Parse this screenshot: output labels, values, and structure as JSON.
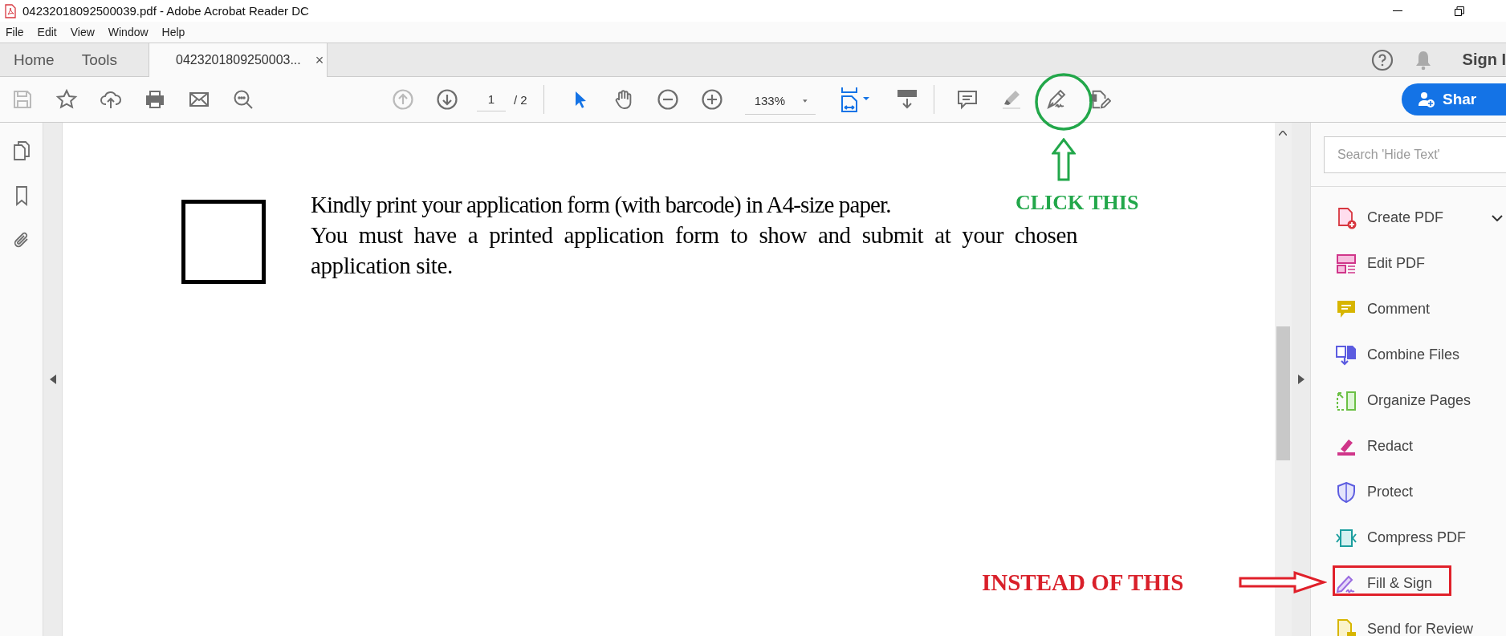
{
  "window": {
    "title": "04232018092500039.pdf - Adobe Acrobat Reader DC"
  },
  "menu": [
    "File",
    "Edit",
    "View",
    "Window",
    "Help"
  ],
  "tabs": [
    {
      "label": "Home",
      "selected": false
    },
    {
      "label": "Tools",
      "selected": false
    },
    {
      "label": "0423201809250003...",
      "selected": true,
      "close": "×"
    }
  ],
  "header_right": {
    "sign_in": "Sign I"
  },
  "toolbar": {
    "file_buttons": [
      {
        "disabled": true
      },
      {
        "disabled": false
      },
      {
        "disabled": false
      },
      {
        "disabled": false
      },
      {
        "disabled": false
      },
      {
        "disabled": false
      }
    ],
    "page_buttons": [
      {
        "disabled": true
      },
      {
        "disabled": false
      }
    ],
    "page_number": "1",
    "page_count": "/ 2",
    "view_tools": [
      {
        "selected": true
      },
      {
        "selected": false
      }
    ],
    "zoom": "133%",
    "share": "Shar"
  },
  "document": {
    "paragraphs": [
      "Kindly print your application form (with barcode) in A4-size paper.",
      "You must have a printed application form to show and submit at your chosen application site."
    ]
  },
  "tools_panel": {
    "search": {
      "placeholder": "Search 'Hide Text'"
    },
    "items": [
      {
        "label": "Create PDF",
        "kind": "create",
        "expanded": true
      },
      {
        "label": "Edit PDF",
        "kind": "edit"
      },
      {
        "label": "Comment",
        "kind": "comment"
      },
      {
        "label": "Combine Files",
        "kind": "combine"
      },
      {
        "label": "Organize Pages",
        "kind": "organize"
      },
      {
        "label": "Redact",
        "kind": "redact"
      },
      {
        "label": "Protect",
        "kind": "protect"
      },
      {
        "label": "Compress PDF",
        "kind": "compress"
      },
      {
        "label": "Fill & Sign",
        "kind": "fillsign"
      },
      {
        "label": "Send for Review",
        "kind": "review"
      }
    ]
  },
  "annotations": {
    "green": "CLICK THIS",
    "red": "INSTEAD OF THIS"
  }
}
